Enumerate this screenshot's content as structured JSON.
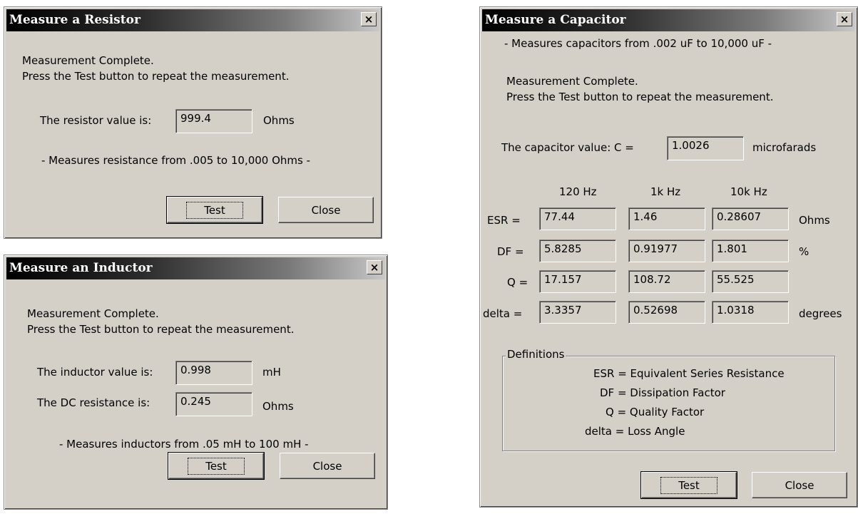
{
  "resistor": {
    "title": "Measure a Resistor",
    "close_x": "×",
    "status1": "Measurement Complete.",
    "status2": "Press the Test button to repeat the measurement.",
    "value_label": "The resistor value is:",
    "value": "999.4",
    "unit": "Ohms",
    "range": "- Measures resistance from .005 to 10,000 Ohms -",
    "test_label": "Test",
    "close_label": "Close"
  },
  "inductor": {
    "title": "Measure an Inductor",
    "close_x": "×",
    "status1": "Measurement Complete.",
    "status2": "Press the Test button to repeat the measurement.",
    "value_label": "The inductor value is:",
    "value": "0.998",
    "unit": "mH",
    "dc_label": "The DC resistance is:",
    "dc_value": "0.245",
    "dc_unit": "Ohms",
    "range": "- Measures inductors from .05 mH to 100 mH -",
    "test_label": "Test",
    "close_label": "Close"
  },
  "capacitor": {
    "title": "Measure a Capacitor",
    "close_x": "×",
    "range": "- Measures capacitors from .002 uF to 10,000 uF -",
    "status1": "Measurement Complete.",
    "status2": "Press the Test button to repeat the measurement.",
    "value_label": "The capacitor value:  C =",
    "value": "1.0026",
    "unit": "microfarads",
    "freq_headers": [
      "120 Hz",
      "1k Hz",
      "10k Hz"
    ],
    "rows": [
      {
        "label": "ESR =",
        "values": [
          "77.44",
          "1.46",
          "0.28607"
        ],
        "unit": "Ohms"
      },
      {
        "label": "DF =",
        "values": [
          "5.8285",
          "0.91977",
          "1.801"
        ],
        "unit": "%"
      },
      {
        "label": "Q =",
        "values": [
          "17.157",
          "108.72",
          "55.525"
        ],
        "unit": ""
      },
      {
        "label": "delta =",
        "values": [
          "3.3357",
          "0.52698",
          "1.0318"
        ],
        "unit": "degrees"
      }
    ],
    "definitions_label": "Definitions",
    "definitions": [
      "ESR = Equivalent Series Resistance",
      "DF = Dissipation Factor",
      "Q = Quality Factor",
      "delta = Loss Angle"
    ],
    "test_label": "Test",
    "close_label": "Close"
  }
}
